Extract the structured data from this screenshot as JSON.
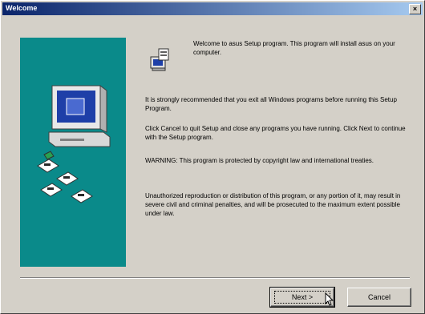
{
  "window": {
    "title": "Welcome",
    "close_label": "×"
  },
  "welcome_text": "Welcome to asus Setup program. This program will install asus on your computer.",
  "paragraphs": {
    "p1": "It is strongly recommended that you exit all Windows programs before running this Setup Program.",
    "p2": "Click Cancel to quit Setup and close any programs you have running. Click Next to continue with the Setup program.",
    "p3": "WARNING: This program is protected by copyright law and international treaties.",
    "p4": "Unauthorized reproduction or distribution of this program, or any portion of it, may result in severe civil and criminal penalties, and will be prosecuted to the maximum extent possible under law."
  },
  "buttons": {
    "next": "Next >",
    "cancel": "Cancel"
  },
  "colors": {
    "title_bar": "#0a246a",
    "panel": "#0a8a8a",
    "face": "#d4d0c8"
  },
  "icons": [
    "setup-computer-icon",
    "setup-box-icon",
    "close-icon",
    "mouse-cursor-icon"
  ]
}
